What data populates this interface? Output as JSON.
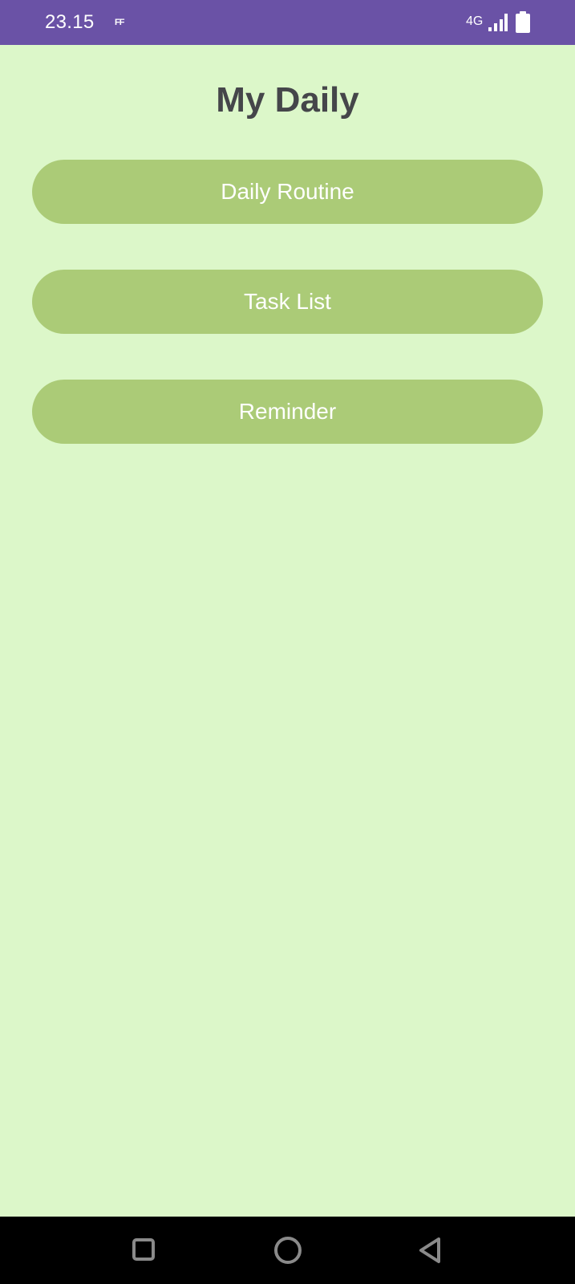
{
  "status_bar": {
    "time": "23.15",
    "indicator": "FF",
    "network": "4G",
    "signal_icon": "signal-icon",
    "battery_icon": "battery-icon",
    "color": "#6a52a6"
  },
  "app": {
    "title": "My Daily",
    "background": "#dcf7c9",
    "button_color": "#abcb77",
    "buttons": [
      {
        "label": "Daily Routine"
      },
      {
        "label": "Task List"
      },
      {
        "label": "Reminder"
      }
    ]
  },
  "nav_bar": {
    "recents_icon": "square-icon",
    "home_icon": "circle-icon",
    "back_icon": "triangle-back-icon"
  }
}
